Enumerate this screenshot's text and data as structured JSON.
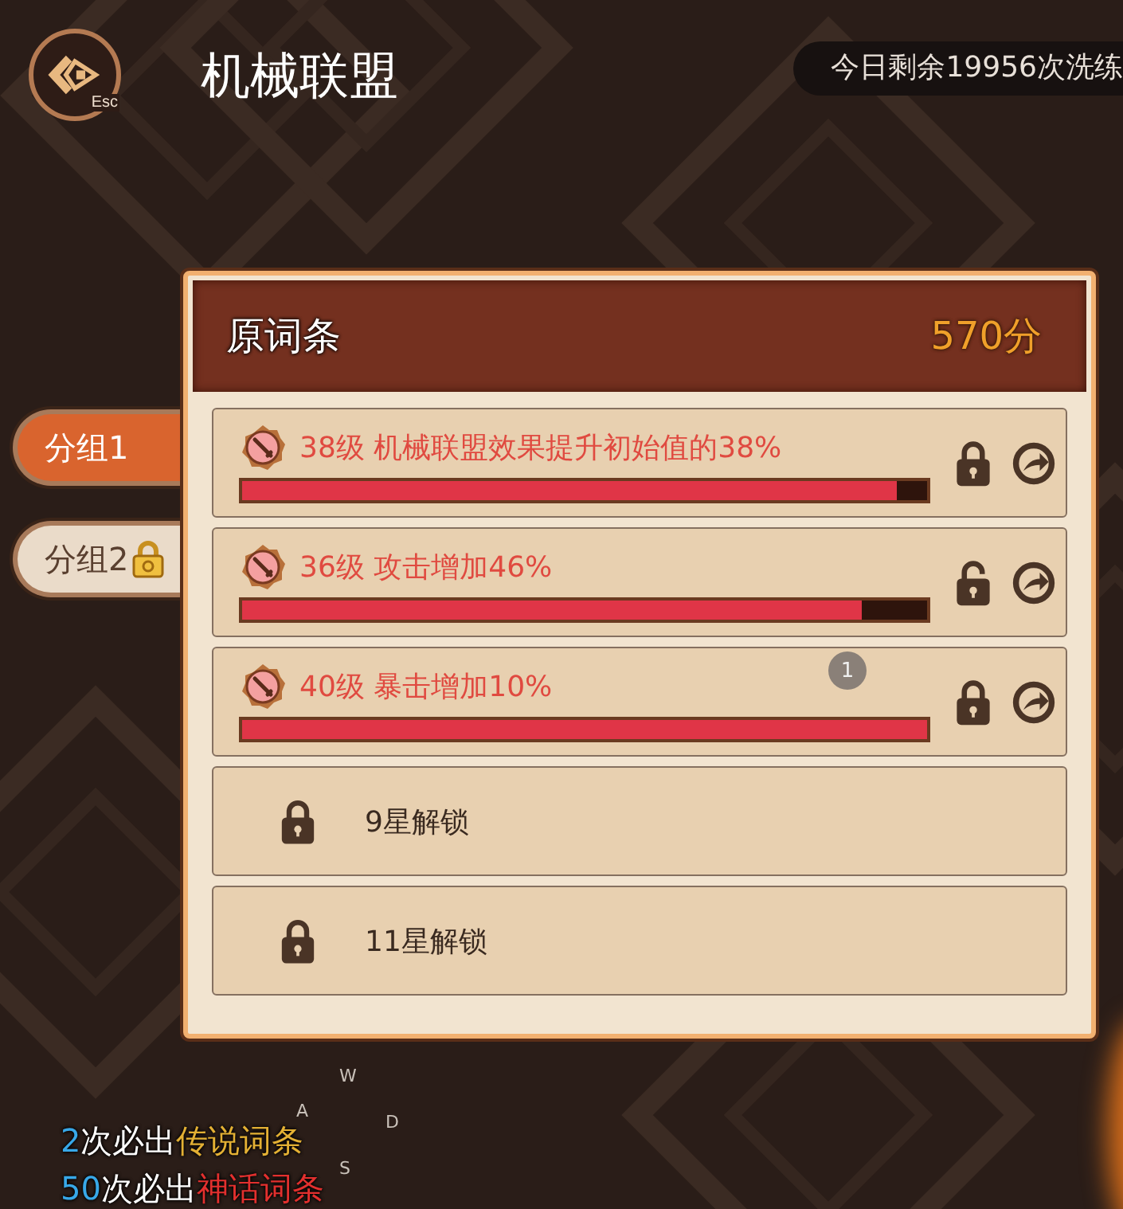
{
  "esc_button": {
    "label": "Esc"
  },
  "title": "机械联盟",
  "refine_counter": "今日剩余19956次洗练",
  "groups": [
    {
      "label": "分组1",
      "selected": true,
      "locked": false
    },
    {
      "label": "分组2",
      "selected": false,
      "locked": true
    }
  ],
  "panel": {
    "title": "原词条",
    "score": "570分",
    "rows": [
      {
        "kind": "affix",
        "text": "38级 机械联盟效果提升初始值的38%",
        "level": 0.955,
        "locked": true
      },
      {
        "kind": "affix",
        "text": "36级 攻击增加46%",
        "level": 0.905,
        "locked": false
      },
      {
        "kind": "affix",
        "text": "40级 暴击增加10%",
        "level": 1.0,
        "locked": true,
        "badge": "1"
      },
      {
        "kind": "slot",
        "text": "9星解锁"
      },
      {
        "kind": "slot",
        "text": "11星解锁"
      }
    ]
  },
  "joystick": {
    "keys": [
      "W",
      "A",
      "D",
      "S"
    ]
  },
  "pity_notes": [
    {
      "count": "2",
      "text": "次必出",
      "reward": "传说词条",
      "color": "#e3b034"
    },
    {
      "count": "50",
      "text": "次必出",
      "reward": "神话词条",
      "color": "#e2302e"
    }
  ]
}
